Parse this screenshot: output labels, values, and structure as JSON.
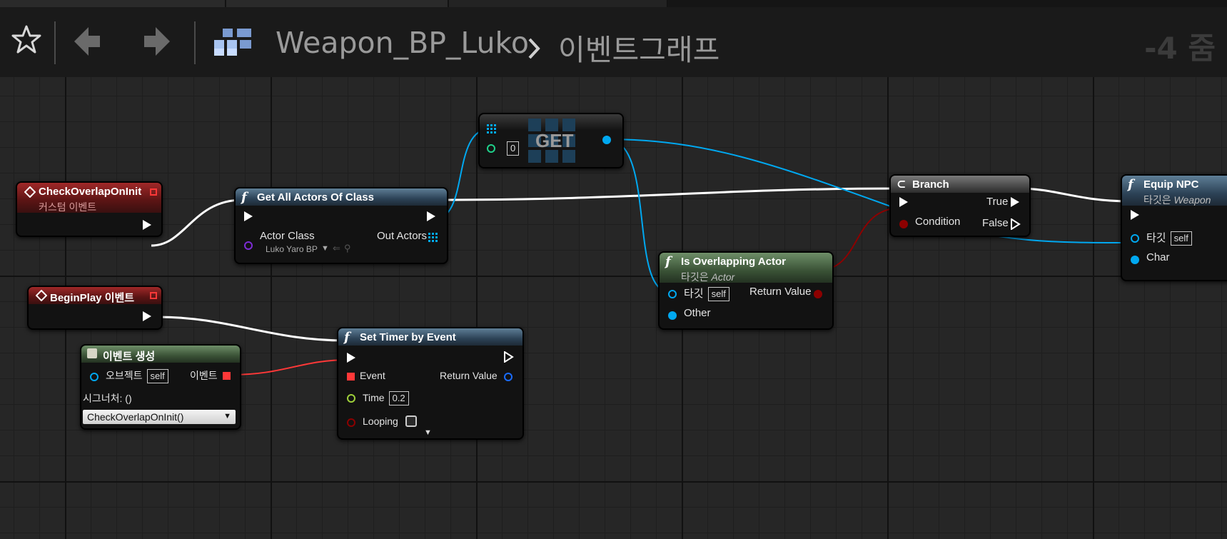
{
  "toolbar": {
    "breadcrumb_blueprint": "Weapon_BP_Luko",
    "breadcrumb_graph": "이벤트그래프",
    "zoom": "-4 줌"
  },
  "nodes": {
    "check_event": {
      "title": "CheckOverlapOnInit",
      "subtitle": "커스텀 이벤트"
    },
    "get_all": {
      "title": "Get All Actors Of Class",
      "pin_actor_class": "Actor Class",
      "actor_class_value": "Luko Yaro BP",
      "pin_out_actors": "Out Actors"
    },
    "get": {
      "title": "GET",
      "index_value": "0"
    },
    "branch": {
      "title": "Branch",
      "pin_condition": "Condition",
      "pin_true": "True",
      "pin_false": "False"
    },
    "equip": {
      "title": "Equip NPC",
      "subtitle": "타깃은 ",
      "subtitle_class": "Weapon",
      "pin_target": "타깃",
      "target_value": "self",
      "pin_char": "Char"
    },
    "overlap": {
      "title": "Is Overlapping Actor",
      "subtitle": "타깃은 ",
      "subtitle_class": "Actor",
      "pin_target": "타깃",
      "target_value": "self",
      "pin_return": "Return Value",
      "pin_other": "Other"
    },
    "beginplay": {
      "title": "BeginPlay 이벤트"
    },
    "create_event": {
      "title": "이벤트 생성",
      "pin_object": "오브젝트",
      "object_value": "self",
      "pin_event": "이벤트",
      "signature": "시그너처: ()",
      "dropdown_value": "CheckOverlapOnInit()"
    },
    "timer": {
      "title": "Set Timer by Event",
      "pin_event": "Event",
      "pin_return": "Return Value",
      "pin_time": "Time",
      "time_value": "0.2",
      "pin_looping": "Looping"
    }
  },
  "colors": {
    "exec_wire": "#ffffff",
    "object_wire": "#00a8f0",
    "bool_wire": "#8c0000",
    "delegate_wire": "#ff3838",
    "class_pin": "#7d2cd6",
    "int_pin": "#1fd18a",
    "float_pin": "#9ed03a"
  }
}
